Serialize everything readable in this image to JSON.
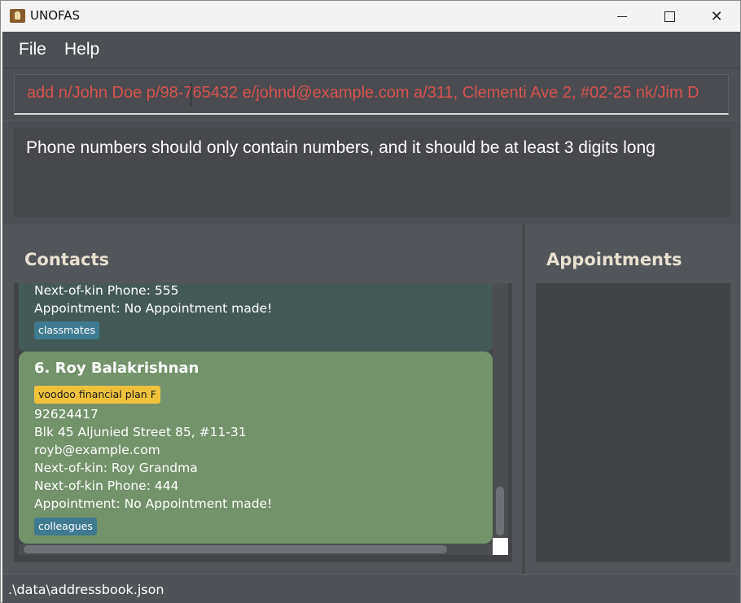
{
  "window": {
    "title": "UNOFAS"
  },
  "menu": {
    "file": "File",
    "help": "Help"
  },
  "command": {
    "value": "add n/John Doe p/98-765432 e/johnd@example.com a/311, Clementi Ave 2, #02-25 nk/Jim D"
  },
  "result": {
    "message": "Phone numbers should only contain numbers, and it should be at least 3 digits long"
  },
  "contacts": {
    "title": "Contacts",
    "previous_card": {
      "nok_phone": "Next-of-kin Phone: 555",
      "appointment": "Appointment: No Appointment made!",
      "tag": "classmates"
    },
    "current_card": {
      "name": "6.  Roy Balakrishnan",
      "plan_tag": "voodoo financial plan F",
      "phone": "92624417",
      "address": "Blk 45 Aljunied Street 85, #11-31",
      "email": "royb@example.com",
      "nok": "Next-of-kin: Roy Grandma",
      "nok_phone": "Next-of-kin Phone: 444",
      "appointment": "Appointment: No Appointment made!",
      "tag": "colleagues"
    }
  },
  "appointments": {
    "title": "Appointments"
  },
  "status": {
    "path": ".\\data\\addressbook.json"
  },
  "colors": {
    "error_text": "#d9534f",
    "plan_tag": "#f0c23b",
    "tag": "#3e7b91",
    "card_selected": "#74926c"
  }
}
